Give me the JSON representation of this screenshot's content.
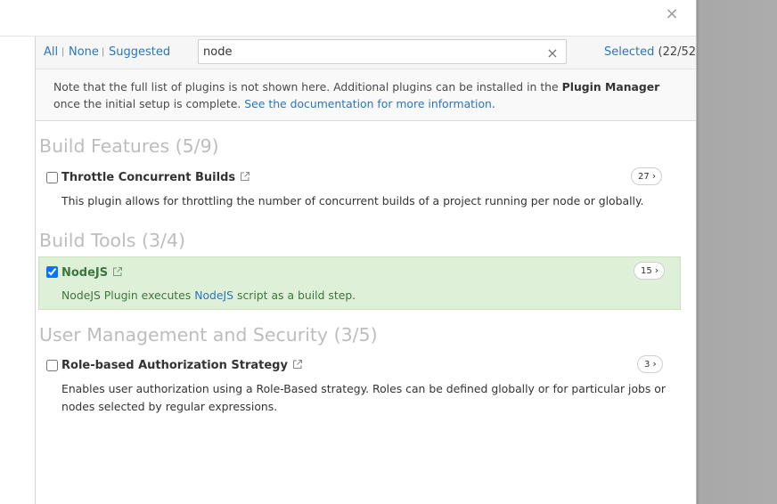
{
  "dialog": {
    "close_label": "×"
  },
  "toolbar": {
    "all_label": "All",
    "none_label": "None",
    "suggested_label": "Suggested",
    "separator": "|",
    "search_value": "node",
    "clear_label": "×",
    "selected_label": "Selected",
    "selected_count": "(22/52)"
  },
  "notice": {
    "text_before": "Note that the full list of plugins is not shown here. Additional plugins can be installed in the ",
    "bold": "Plugin Manager",
    "text_after": " once the initial setup is complete. ",
    "link": "See the documentation for more information",
    "period": "."
  },
  "sections": [
    {
      "title": "Build Features (5/9)",
      "plugins": [
        {
          "name": "Throttle Concurrent Builds",
          "checked": false,
          "description": "This plugin allows for throttling the number of concurrent builds of a project running per node or globally.",
          "dependencies": "27"
        }
      ]
    },
    {
      "title": "Build Tools (3/4)",
      "plugins": [
        {
          "name": "NodeJS",
          "checked": true,
          "desc_before": "NodeJS Plugin executes ",
          "desc_link": "NodeJS",
          "desc_after": " script as a build step.",
          "dependencies": "15"
        }
      ]
    },
    {
      "title": "User Management and Security (3/5)",
      "plugins": [
        {
          "name": "Role-based Authorization Strategy",
          "checked": false,
          "description": "Enables user authorization using a Role-Based strategy. Roles can be defined globally or for particular jobs or nodes selected by regular expressions.",
          "dependencies": "3"
        }
      ]
    }
  ],
  "icons": {
    "external": "external-link-icon",
    "chevron": "chevron-right-icon",
    "close": "close-icon"
  },
  "colors": {
    "link": "#2b76ba",
    "selected_bg": "#dff0d8",
    "selected_text": "#3c763d",
    "section_title": "#bdbdbd"
  }
}
